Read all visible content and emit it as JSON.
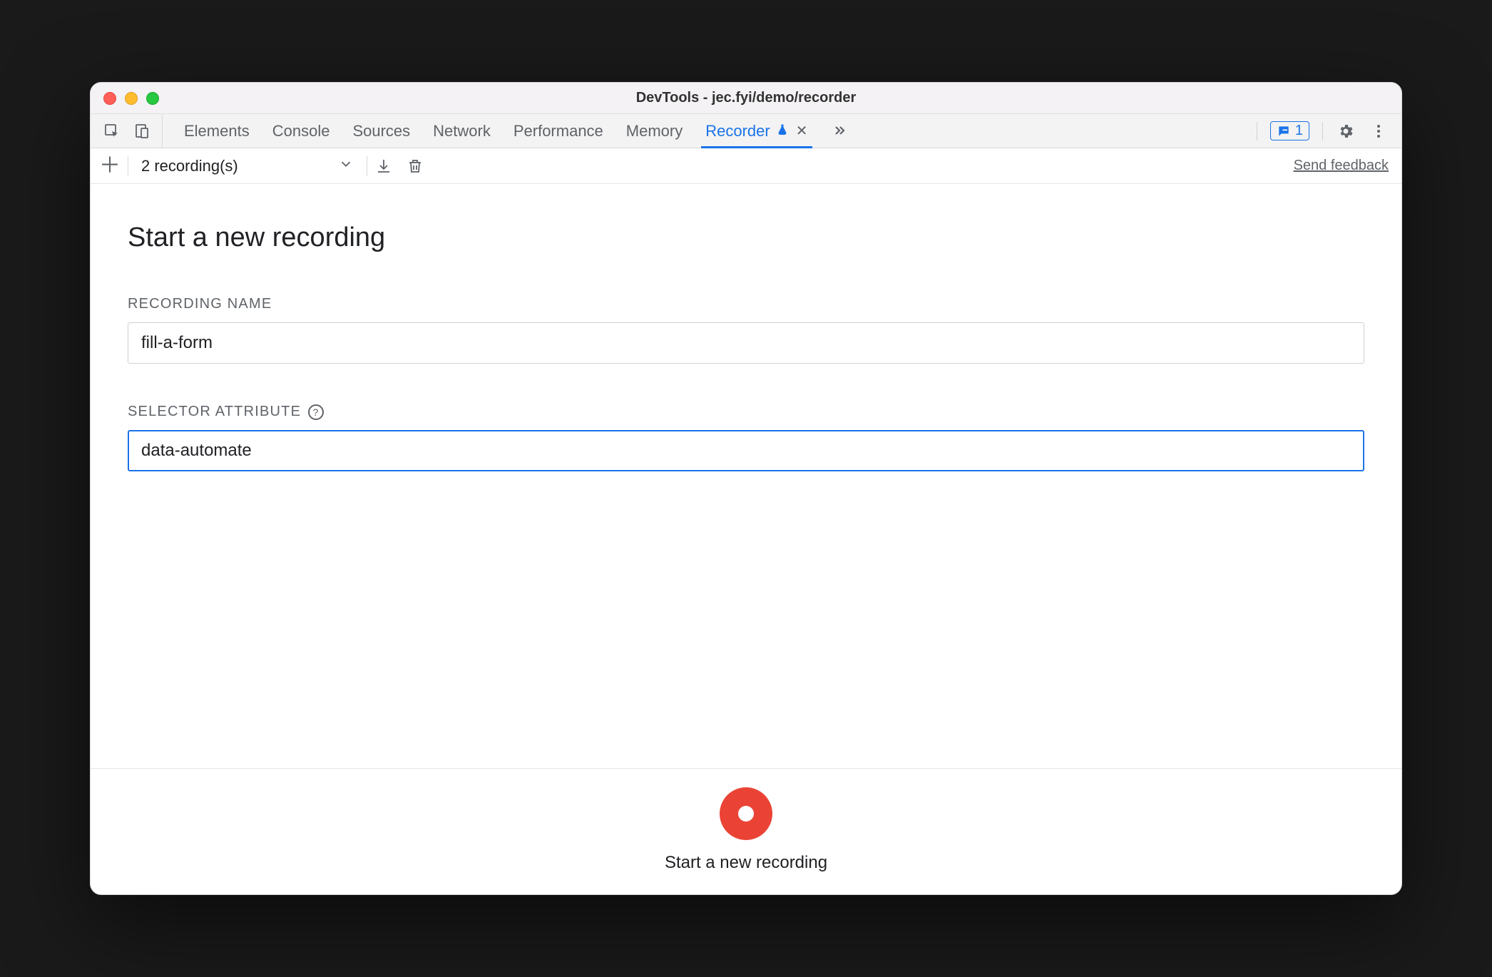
{
  "window": {
    "title": "DevTools - jec.fyi/demo/recorder"
  },
  "tabs": {
    "items": [
      {
        "label": "Elements"
      },
      {
        "label": "Console"
      },
      {
        "label": "Sources"
      },
      {
        "label": "Network"
      },
      {
        "label": "Performance"
      },
      {
        "label": "Memory"
      }
    ],
    "active": {
      "label": "Recorder"
    },
    "issues_count": "1"
  },
  "toolbar": {
    "recordings_label": "2 recording(s)",
    "feedback_label": "Send feedback"
  },
  "form": {
    "page_title": "Start a new recording",
    "name_label": "RECORDING NAME",
    "name_value": "fill-a-form",
    "selector_label": "SELECTOR ATTRIBUTE",
    "selector_value": "data-automate"
  },
  "footer": {
    "start_label": "Start a new recording"
  }
}
